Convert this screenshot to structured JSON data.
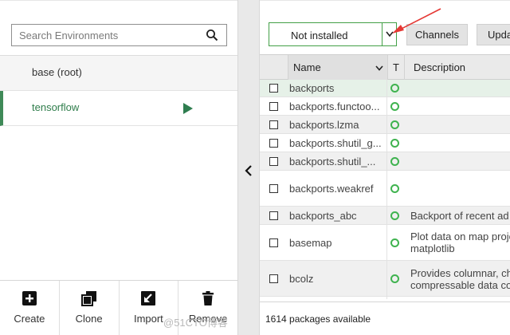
{
  "search": {
    "placeholder": "Search Environments"
  },
  "environments": [
    {
      "label": "base (root)"
    },
    {
      "label": "tensorflow"
    }
  ],
  "env_actions": {
    "create": "Create",
    "clone": "Clone",
    "import": "Import",
    "remove": "Remove"
  },
  "toolbar": {
    "filter_value": "Not installed",
    "channels_label": "Channels",
    "update_label": "Upda"
  },
  "table": {
    "headers": {
      "name": "Name",
      "type": "T",
      "description": "Description"
    },
    "rows": [
      {
        "name": "backports",
        "description": ""
      },
      {
        "name": "backports.functoo...",
        "description": ""
      },
      {
        "name": "backports.lzma",
        "description": ""
      },
      {
        "name": "backports.shutil_g...",
        "description": ""
      },
      {
        "name": "backports.shutil_...",
        "description": ""
      },
      {
        "name": "backports.weakref",
        "description": ""
      },
      {
        "name": "backports_abc",
        "description": "Backport of recent ad"
      },
      {
        "name": "basemap",
        "description": "Plot data on map proje",
        "description2": "matplotlib"
      },
      {
        "name": "bcolz",
        "description": "Provides columnar, ch",
        "description2": "compressable data co"
      }
    ]
  },
  "status": {
    "package_count": "1614 packages available"
  },
  "watermark": "@51CTO博客",
  "colors": {
    "accent_green": "#43a047",
    "active_env": "#2f7d4b",
    "annotation_arrow": "#e53935"
  }
}
